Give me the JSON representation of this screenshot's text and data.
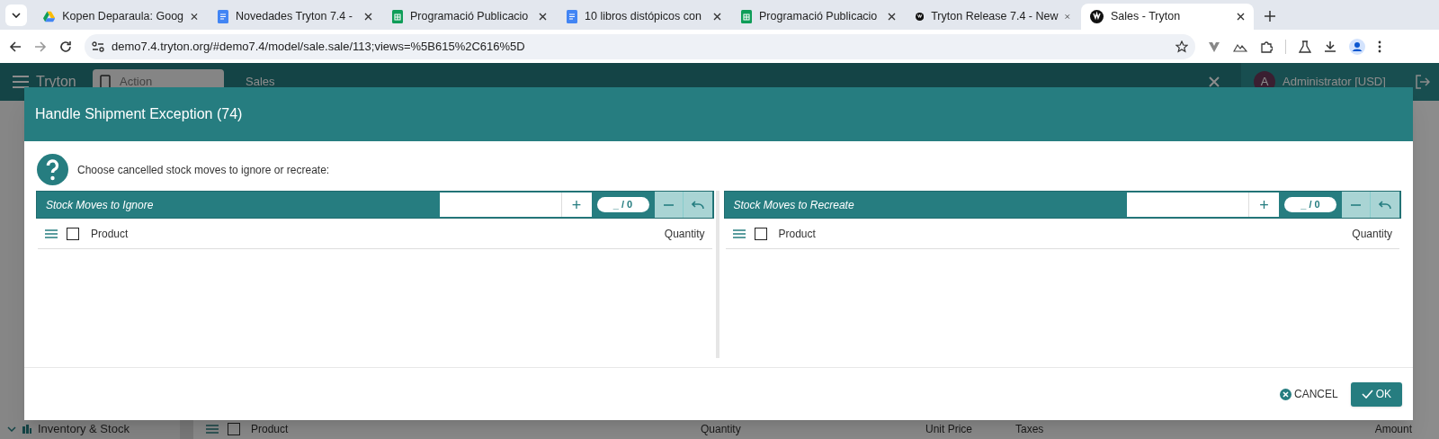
{
  "browser": {
    "tabs": [
      {
        "title": "Kopen Deparaula: Goog",
        "kind": "drive",
        "selected": false
      },
      {
        "title": "Novedades Tryton 7.4 -",
        "kind": "docs",
        "selected": false
      },
      {
        "title": "Programació Publicacio",
        "kind": "sheets",
        "selected": false
      },
      {
        "title": "10 libros distópicos con",
        "kind": "docs",
        "selected": false
      },
      {
        "title": "Programació Publicacio",
        "kind": "sheets",
        "selected": false
      },
      {
        "title": "Tryton Release 7.4 - New",
        "kind": "tryton",
        "selected": false
      },
      {
        "title": "Sales - Tryton",
        "kind": "tryton",
        "selected": true
      }
    ],
    "url": "demo7.4.tryton.org/#demo7.4/model/sale.sale/113;views=%5B615%2C616%5D"
  },
  "app": {
    "brand": "Tryton",
    "action_placeholder": "Action",
    "tab_title": "Sales",
    "user_initial": "A",
    "user": "Administrator [USD]",
    "sidebar": [
      {
        "label": "Inventory & Stock",
        "expanded": true
      }
    ],
    "lines_select_all": {
      "checked": false
    },
    "lines_columns": [
      "Product",
      "Quantity",
      "Unit Price",
      "Taxes",
      "Amount"
    ]
  },
  "dialog": {
    "title": "Handle Shipment Exception (74)",
    "message": "Choose cancelled stock moves to ignore or recreate:",
    "panels": [
      {
        "title": "Stock Moves to Ignore",
        "add_button": "+",
        "counter": "_ / 0",
        "select_all": {
          "checked": false
        },
        "columns": [
          "Product",
          "Quantity"
        ]
      },
      {
        "title": "Stock Moves to Recreate",
        "add_button": "+",
        "counter": "_ / 0",
        "select_all": {
          "checked": false
        },
        "columns": [
          "Product",
          "Quantity"
        ]
      }
    ],
    "buttons": [
      {
        "label": "CANCEL",
        "kind": "cancel"
      },
      {
        "label": "OK",
        "kind": "ok"
      }
    ]
  }
}
